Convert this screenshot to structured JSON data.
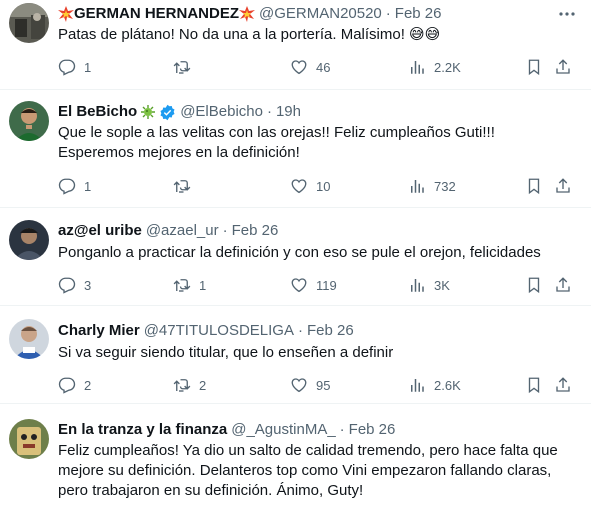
{
  "tweets": [
    {
      "name": "GERMAN HERNANDEZ",
      "handle": "@GERMAN20520",
      "time": "Feb 26",
      "lines": [
        "Patas de plátano! No da una a la portería. Malísimo! 😅😅"
      ],
      "replies": "1",
      "retweets": "",
      "likes": "46",
      "views": "2.2K",
      "name_icons": [
        "explosion-emoji-icon",
        "explosion-emoji-icon"
      ],
      "verified": false
    },
    {
      "name": "El BeBicho",
      "handle": "@ElBebicho",
      "time": "19h",
      "lines": [
        "Que le sople a las velitas con las orejas!! Feliz cumpleaños Guti!!!",
        "Esperemos mejores en la definición!"
      ],
      "replies": "1",
      "retweets": "",
      "likes": "10",
      "views": "732",
      "name_icons": [
        "virus-emoji-icon"
      ],
      "verified": true
    },
    {
      "name": "az@el uribe",
      "handle": "@azael_ur",
      "time": "Feb 26",
      "lines": [
        "Ponganlo a practicar la definición y con eso se pule el orejon, felicidades"
      ],
      "replies": "3",
      "retweets": "1",
      "likes": "119",
      "views": "3K",
      "name_icons": [],
      "verified": false
    },
    {
      "name": "Charly Mier",
      "handle": "@47TITULOSDELIGA",
      "time": "Feb 26",
      "lines": [
        "Si va seguir siendo titular, que lo enseñen a definir"
      ],
      "replies": "2",
      "retweets": "2",
      "likes": "95",
      "views": "2.6K",
      "name_icons": [],
      "verified": false
    },
    {
      "name": "En la tranza y la finanza",
      "handle": "@_AgustinMA_",
      "time": "Feb 26",
      "lines": [
        "Feliz cumpleaños! Ya dio un salto de calidad tremendo, pero hace falta que",
        "mejore su definición. Delanteros top como Vini empezaron fallando claras,",
        "pero trabajaron en su definición. Ánimo, Guty!"
      ],
      "replies": "",
      "retweets": "",
      "likes": "",
      "views": "",
      "name_icons": [],
      "verified": false
    }
  ],
  "icons": {
    "reply": "reply-icon",
    "retweet": "retweet-icon",
    "like": "heart-icon",
    "views": "views-icon",
    "bookmark": "bookmark-icon",
    "share": "share-icon",
    "more": "more-icon",
    "verified": "verified-badge-icon"
  },
  "colors": {
    "text": "#0f1419",
    "muted": "#536471",
    "verified": "#1d9bf0",
    "divider": "#eff3f4"
  }
}
